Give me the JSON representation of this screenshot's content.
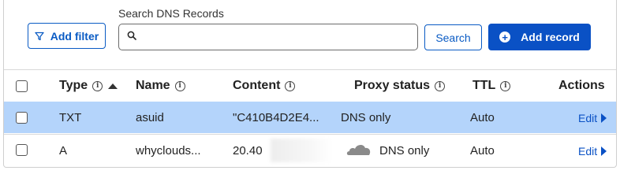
{
  "toolbar": {
    "search_label": "Search DNS Records",
    "search_value": "",
    "add_filter_label": "Add filter",
    "search_button_label": "Search",
    "add_record_label": "Add record"
  },
  "table": {
    "columns": [
      "Type",
      "Name",
      "Content",
      "Proxy status",
      "TTL",
      "Actions"
    ],
    "rows": [
      {
        "type": "TXT",
        "name": "asuid",
        "content": "\"C410B4D2E4...",
        "proxy_status": "DNS only",
        "ttl": "Auto",
        "action": "Edit",
        "selected": true
      },
      {
        "type": "A",
        "name": "whyclouds...",
        "content": "20.40",
        "proxy_status": "DNS only",
        "ttl": "Auto",
        "action": "Edit",
        "selected": false
      }
    ]
  },
  "icons": {
    "filter": "filter-icon",
    "search": "search-icon",
    "add": "plus-circle-icon",
    "info": "info-icon",
    "sort": "sort-ascending-icon",
    "cloud": "cloud-icon",
    "edit_arrow": "chevron-right-icon"
  },
  "colors": {
    "primary": "#0a51c5",
    "selected_row": "#b4d4fb",
    "cloud_gray": "#8a8a8a"
  }
}
